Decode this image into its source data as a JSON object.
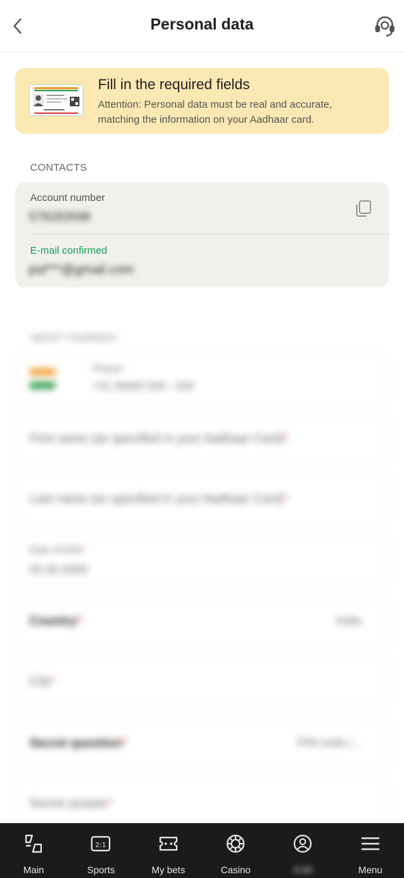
{
  "header": {
    "title": "Personal data",
    "back_icon": "chevron-left-icon",
    "support_icon": "headset-icon"
  },
  "notice": {
    "title": "Fill in the required fields",
    "text": "Attention: Personal data must be real and accurate, matching the information on your Aadhaar card.",
    "background": "#fbe8b3"
  },
  "contacts": {
    "section_label": "CONTACTS",
    "account_label": "Account number",
    "account_value": "578283598",
    "email_label": "E-mail confirmed",
    "email_value": "pol***@gmail.com",
    "email_label_color": "#13a05a"
  },
  "blurred_form": {
    "section_label": "ABOUT YOURSELF",
    "phone_label": "Phone",
    "phone_value": "+91 00000 000 - 000",
    "first_name_placeholder": "First name (as specified in your Aadhaar Card)",
    "last_name_placeholder": "Last name (as specified in your Aadhaar Card)",
    "dob_label": "Date of birth",
    "dob_value": "00.00.0000",
    "country_label": "Country",
    "country_value": "India",
    "city_placeholder": "City",
    "secret_question_label": "Secret question",
    "secret_question_value": "PIN code i...",
    "secret_answer_placeholder": "Secret answer",
    "required_mark": "*"
  },
  "bottom_nav": {
    "items": [
      {
        "label": "Main",
        "icon": "home-icon"
      },
      {
        "label": "Sports",
        "icon": "scoreboard-icon"
      },
      {
        "label": "My bets",
        "icon": "ticket-icon"
      },
      {
        "label": "Casino",
        "icon": "casino-chip-icon"
      },
      {
        "label": "0.00",
        "icon": "user-circle-icon"
      },
      {
        "label": "Menu",
        "icon": "menu-icon"
      }
    ]
  }
}
